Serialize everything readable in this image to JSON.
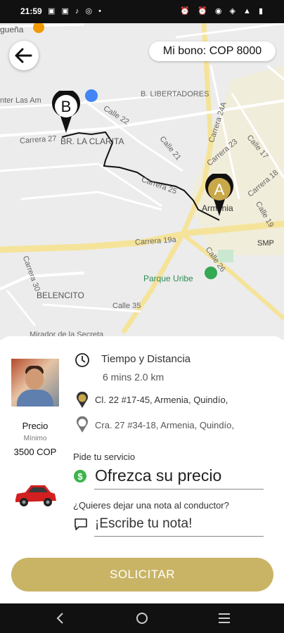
{
  "status_bar": {
    "time": "21:59"
  },
  "header": {
    "bonus": "Mi bono: COP 8000"
  },
  "map": {
    "labels": {
      "top_left": "gueña",
      "center_las": "nter Las Am",
      "libertadores": "B. LIBERTADORES",
      "calle22": "Calle 22",
      "carrera27": "Carrera 27",
      "la_clarita": "BR. LA CLARITA",
      "calle21": "Calle 21",
      "carrera24a": "Carrera 24A",
      "carrera23": "Carrera 23",
      "calle17": "Calle 17",
      "carrera18": "Carrera 18",
      "carrera25": "Carrera 25",
      "armenia": "Armenia",
      "calle19": "Calle 19",
      "carrera19a": "Carrera 19a",
      "smp": "SMP",
      "calle26": "Calle 26",
      "carrera30": "Carrera 30",
      "parque_uribe": "Parque Uribe",
      "belencito": "BELENCITO",
      "calle35": "Calle 35",
      "mirador": "Mirador de la Secreta"
    },
    "marker_a": "A",
    "marker_b": "B"
  },
  "driver": {
    "price_title": "Precio",
    "price_min": "Mínimo",
    "price_value": "3500 COP"
  },
  "trip": {
    "heading": "Tiempo y Distancia",
    "time_distance": "6 mins 2.0 km",
    "origin": "Cl. 22 #17-45, Armenia, Quindío,",
    "destination": "Cra. 27 #34-18, Armenia, Quindío,"
  },
  "form": {
    "service_label": "Pide tu servicio",
    "offer_placeholder": "Ofrezca su precio",
    "note_question": "¿Quieres dejar una nota al conductor?",
    "note_placeholder": "¡Escribe tu nota!"
  },
  "actions": {
    "request": "SOLICITAR"
  },
  "colors": {
    "accent": "#c9b466",
    "marker": "#c9a84a",
    "dollar": "#3cb44b"
  },
  "icons": {
    "back": "arrow-left-icon",
    "clock": "clock-icon",
    "origin": "pin-a-icon",
    "destination": "pin-b-icon",
    "dollar": "dollar-icon",
    "note": "chat-bubble-icon",
    "car": "red-car-icon"
  }
}
